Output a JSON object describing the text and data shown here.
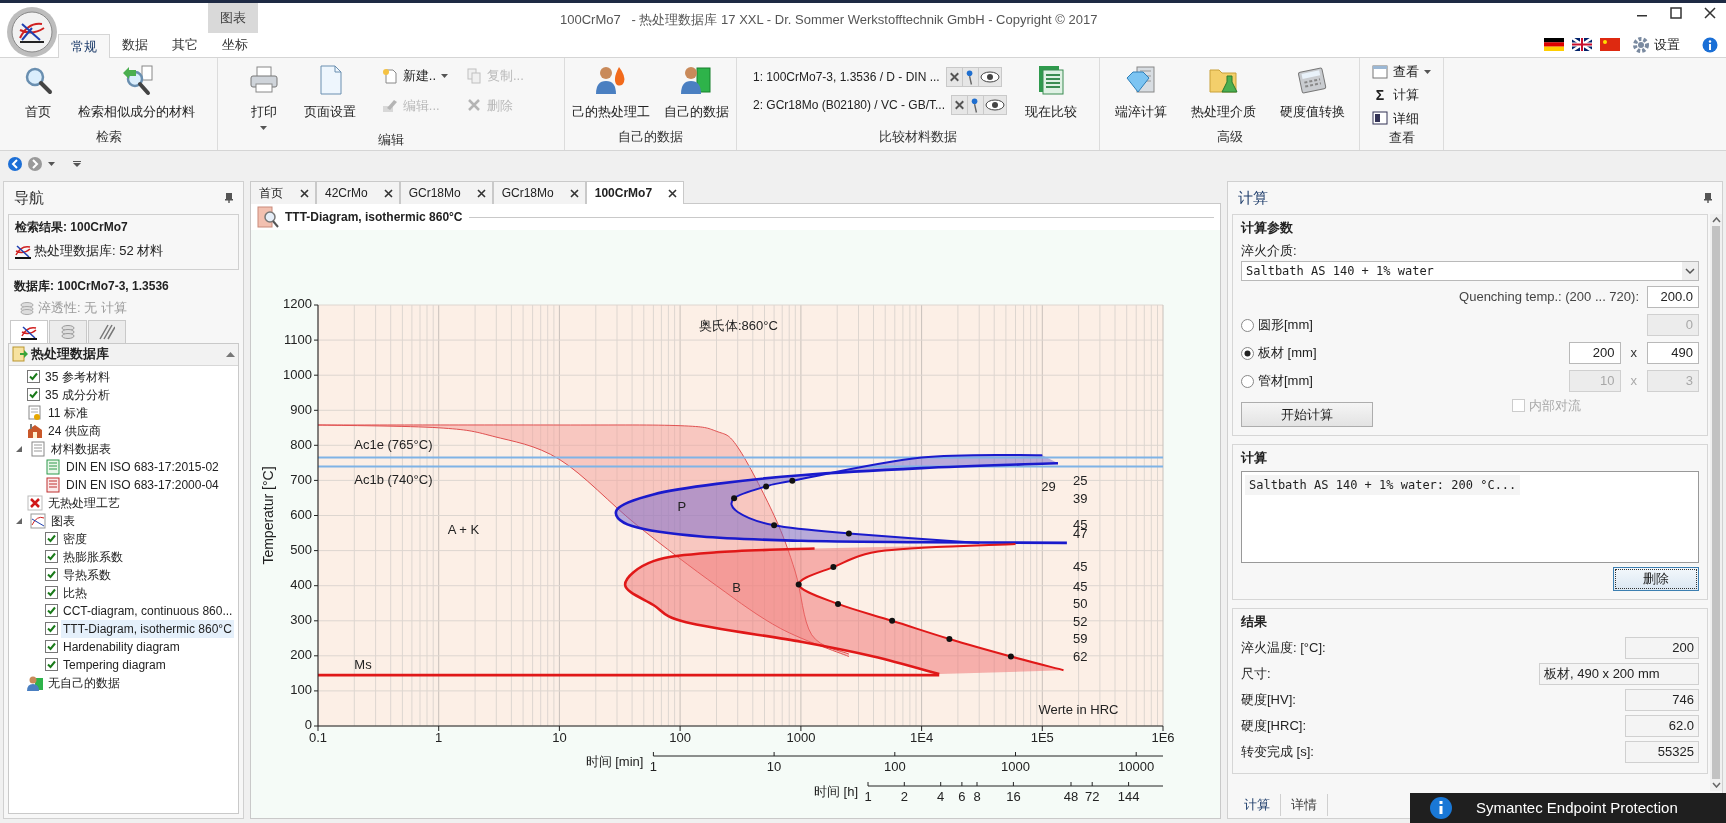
{
  "window": {
    "title": "100CrMo7   - 热处理数据库 17 XXL - Dr. Sommer Werkstofftechnik GmbH - Copyright © 2017",
    "contextual_tab": "图表",
    "settings": "设置"
  },
  "ribbon_tabs": [
    {
      "label": "常规",
      "selected": true
    },
    {
      "label": "数据",
      "selected": false
    },
    {
      "label": "其它",
      "selected": false
    },
    {
      "label": "坐标",
      "selected": false
    }
  ],
  "ribbon_groups": [
    {
      "label": "检索",
      "items": [
        {
          "kind": "large",
          "label": "首页"
        },
        {
          "kind": "large",
          "label": "检索相似成分的材料"
        }
      ]
    },
    {
      "label": "编辑",
      "items": [
        {
          "kind": "large",
          "label": "打印",
          "dropdown": true
        },
        {
          "kind": "large",
          "label": "页面设置"
        }
      ],
      "small_items": [
        {
          "label": "新建..",
          "dropdown": true,
          "disabled": false
        },
        {
          "label": "复制...",
          "disabled": true
        },
        {
          "label": "编辑...",
          "disabled": true
        },
        {
          "label": "删除",
          "disabled": true
        }
      ]
    },
    {
      "label": "自己的数据",
      "items": [
        {
          "kind": "large",
          "label": "己的热处理工"
        },
        {
          "kind": "large",
          "label": "自己的数据"
        }
      ]
    },
    {
      "label": "比较材料数据",
      "items": [
        {
          "kind": "compare",
          "label": "1: 100CrMo7-3, 1.3536 / D - DIN ..."
        },
        {
          "kind": "compare",
          "label": "2: GCr18Mo (B02180) / VC - GB/T..."
        },
        {
          "kind": "large",
          "label": "现在比较"
        }
      ]
    },
    {
      "label": "高级",
      "items": [
        {
          "kind": "large",
          "label": "端淬计算"
        },
        {
          "kind": "large",
          "label": "热处理介质"
        },
        {
          "kind": "large",
          "label": "硬度值转换"
        }
      ]
    },
    {
      "label": "查看",
      "items": [
        {
          "kind": "small",
          "label": "查看",
          "dropdown": true,
          "disabled": false
        },
        {
          "kind": "small",
          "label": "计算",
          "icon_text": "Σ",
          "disabled": false
        },
        {
          "kind": "small",
          "label": "详细",
          "disabled": false
        }
      ]
    }
  ],
  "navigation": {
    "title": "导航",
    "search_result": {
      "heading": "检索结果: 100CrMo7",
      "item": "热处理数据库: 52 材料"
    },
    "database": {
      "heading": "数据库: 100CrMo7-3, 1.3536",
      "hardenability": "淬透性: 无 计算",
      "tabs": [
        {
          "selected": true
        },
        {
          "selected": false
        },
        {
          "selected": false
        }
      ],
      "tree_header": "热处理数据库",
      "tree": [
        {
          "kind": "check",
          "label": "35 参考材料",
          "checked": true
        },
        {
          "kind": "check",
          "label": "35 成分分析",
          "checked": true
        },
        {
          "kind": "standard",
          "label": "11 标准"
        },
        {
          "kind": "supplier",
          "label": "24 供应商"
        },
        {
          "kind": "sheets",
          "label": "材料数据表",
          "expanded": true,
          "children": [
            {
              "kind": "sheet-green",
              "label": "DIN EN ISO 683-17:2015-02"
            },
            {
              "kind": "sheet-red",
              "label": "DIN EN ISO 683-17:2000-04"
            }
          ]
        },
        {
          "kind": "none",
          "label": "无热处理工艺"
        },
        {
          "kind": "charts",
          "label": "图表",
          "expanded": true,
          "children": [
            {
              "kind": "check",
              "label": "密度",
              "checked": true,
              "selected": false
            },
            {
              "kind": "check",
              "label": "热膨胀系数",
              "checked": true,
              "selected": false
            },
            {
              "kind": "check",
              "label": "导热系数",
              "checked": true,
              "selected": false
            },
            {
              "kind": "check",
              "label": "比热",
              "checked": true,
              "selected": false
            },
            {
              "kind": "check",
              "label": "CCT-diagram, continuous 860...",
              "checked": true,
              "selected": false
            },
            {
              "kind": "check",
              "label": "TTT-Diagram, isothermic 860°C",
              "checked": true,
              "selected": true
            },
            {
              "kind": "check",
              "label": "Hardenability diagram",
              "checked": true,
              "selected": false
            },
            {
              "kind": "check",
              "label": "Tempering diagram",
              "checked": true,
              "selected": false
            }
          ]
        },
        {
          "kind": "own",
          "label": "无自己的数据"
        }
      ]
    }
  },
  "document_tabs": [
    {
      "label": "首页",
      "selected": false
    },
    {
      "label": "42CrMo",
      "selected": false
    },
    {
      "label": "GCr18Mo",
      "selected": false
    },
    {
      "label": "GCr18Mo",
      "selected": false
    },
    {
      "label": "100CrMo7",
      "selected": true
    }
  ],
  "document": {
    "title": "TTT-Diagram, isothermic 860°C",
    "diagram": {
      "y_axis_title": "Temperatur [°C]",
      "y_ticks": [
        "1200",
        "1100",
        "1000",
        "900",
        "800",
        "700",
        "600",
        "500",
        "400",
        "300",
        "200",
        "100",
        "0"
      ],
      "x_ticks": [
        "0.1",
        "1",
        "10",
        "100",
        "1000",
        "1E4",
        "1E5",
        "1E6"
      ],
      "labels": [
        "奥氏体:860°C",
        "Ac1e (765°C)",
        "Ac1b (740°C)",
        "A + K",
        "P",
        "B",
        "Ms"
      ],
      "hardness_values": [
        "29",
        "25",
        "39",
        "45",
        "47",
        "45",
        "45",
        "50",
        "52",
        "59",
        "62"
      ],
      "note": "Werte in HRC",
      "minute_axis": {
        "label": "时间 [min]",
        "ticks": [
          "1",
          "10",
          "100",
          "1000",
          "10000"
        ]
      },
      "hour_axis": {
        "label": "时间 [h]",
        "ticks": [
          "1",
          "2",
          "4",
          "6",
          "8",
          "16",
          "48",
          "72",
          "144"
        ]
      }
    }
  },
  "calculation": {
    "title": "计算",
    "parameters": {
      "heading": "计算参数",
      "medium_label": "淬火介质:",
      "medium_value": "Saltbath AS 140 + 1% water",
      "quench_label": "Quenching temp.: (200 ... 720):",
      "quench_value": "200.0",
      "shapes": [
        {
          "label": "圆形[mm]",
          "selected": false,
          "values": [
            "0"
          ]
        },
        {
          "label": "板材 [mm]",
          "selected": true,
          "values": [
            "200",
            "490"
          ],
          "times": "x"
        },
        {
          "label": "管材[mm]",
          "selected": false,
          "values": [
            "10",
            "3"
          ],
          "times": "x"
        }
      ],
      "internal_convection": {
        "label": "内部对流",
        "checked": false,
        "disabled": true
      },
      "start_button": "开始计算"
    },
    "calculations": {
      "heading": "计算",
      "entries": [
        "Saltbath AS 140 + 1% water: 200 °C..."
      ],
      "delete_button": "删除"
    },
    "results": {
      "heading": "结果",
      "rows": [
        {
          "kind": "number",
          "label": "淬火温度: [°C]:",
          "value": "200"
        },
        {
          "kind": "wide",
          "label": "尺寸:",
          "value": "板材, 490 x 200 mm"
        },
        {
          "kind": "number",
          "label": "硬度[HV]:",
          "value": "746"
        },
        {
          "kind": "number",
          "label": "硬度[HRC]:",
          "value": "62.0"
        },
        {
          "kind": "number",
          "label": "转变完成 [s]:",
          "value": "55325"
        }
      ]
    },
    "tabs": [
      {
        "label": "计算",
        "selected": true
      },
      {
        "label": "详情",
        "selected": false
      }
    ]
  },
  "notification": {
    "title": "Symantec Endpoint Protection"
  }
}
